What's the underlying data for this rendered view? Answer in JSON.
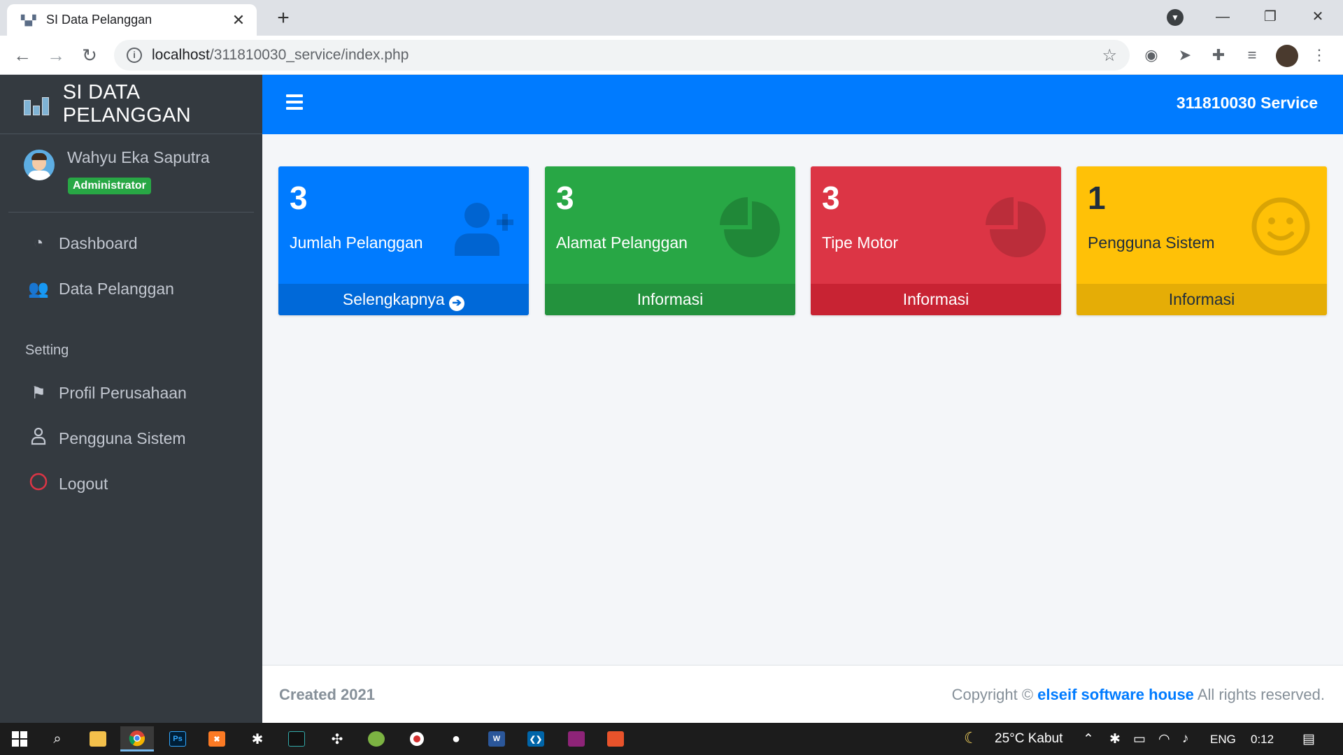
{
  "browser": {
    "tab_title": "SI Data Pelanggan",
    "url_host": "localhost",
    "url_path": "/311810030_service/index.php"
  },
  "sidebar": {
    "brand": "SI DATA PELANGGAN",
    "user_name": "Wahyu Eka Saputra",
    "user_role": "Administrator",
    "menu": [
      {
        "label": "Dashboard",
        "icon": "dashboard-icon"
      },
      {
        "label": "Data Pelanggan",
        "icon": "users-icon"
      }
    ],
    "setting_header": "Setting",
    "setting_menu": [
      {
        "label": "Profil Perusahaan",
        "icon": "flag-icon"
      },
      {
        "label": "Pengguna Sistem",
        "icon": "user-icon"
      },
      {
        "label": "Logout",
        "icon": "logout-circle-icon"
      }
    ]
  },
  "navbar": {
    "right_text": "311810030 Service"
  },
  "boxes": [
    {
      "number": "3",
      "label": "Jumlah Pelanggan",
      "footer": "Selengkapnya",
      "icon": "user-plus-icon",
      "color": "#007bff"
    },
    {
      "number": "3",
      "label": "Alamat Pelanggan",
      "footer": "Informasi",
      "icon": "pie-chart-icon",
      "color": "#28a745"
    },
    {
      "number": "3",
      "label": "Tipe Motor",
      "footer": "Informasi",
      "icon": "pie-chart-icon",
      "color": "#dc3545"
    },
    {
      "number": "1",
      "label": "Pengguna Sistem",
      "footer": "Informasi",
      "icon": "smile-icon",
      "color": "#ffc107"
    }
  ],
  "footer": {
    "left": "Created 2021",
    "right_prefix": "Copyright © ",
    "right_brand": "elseif software house",
    "right_suffix": " All rights reserved."
  },
  "taskbar": {
    "weather": "25°C  Kabut",
    "language": "ENG",
    "time": "0:12"
  }
}
